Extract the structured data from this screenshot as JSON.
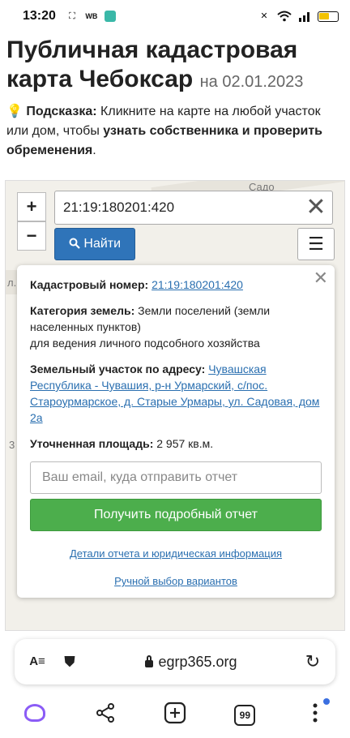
{
  "status_bar": {
    "time": "13:20",
    "wb_label": "WB"
  },
  "page": {
    "title": "Публичная кадастровая карта Чебоксар",
    "date": "на 02.01.2023",
    "hint_label": "Подсказка:",
    "hint_text_1": "Кликните на карте на любой участок или дом, чтобы",
    "hint_bold": "узнать собственника и проверить обременения",
    "hint_end": "."
  },
  "map": {
    "zoom_in": "+",
    "zoom_out": "−",
    "search_value": "21:19:180201:420",
    "search_clear": "✕",
    "find_label": "Найти",
    "menu_label": "☰",
    "road_labels": [
      "Садо",
      "л.",
      "3"
    ]
  },
  "popup": {
    "close": "✕",
    "cadastral_label": "Кадастровый номер:",
    "cadastral_value": "21:19:180201:420",
    "category_label": "Категория земель:",
    "category_value": "Земли поселений (земли населенных пунктов)",
    "category_use": "для ведения личного подсобного хозяйства",
    "address_label": "Земельный участок по адресу:",
    "address_value": "Чувашская Республика - Чувашия, р-н Урмарский, с/пос. Староурмарское, д. Старые Урмары, ул. Садовая, дом 2а",
    "area_label": "Уточненная площадь:",
    "area_value": "2 957 кв.м.",
    "email_placeholder": "Ваш email, куда отправить отчет",
    "report_button": "Получить подробный отчет",
    "details_link": "Детали отчета и юридическая информация",
    "manual_link": "Ручной выбор вариантов"
  },
  "browser": {
    "url": "egrp365.org",
    "tabs_count": "99",
    "reader_icon": "reader-mode-icon",
    "reload_icon": "reload-icon"
  }
}
